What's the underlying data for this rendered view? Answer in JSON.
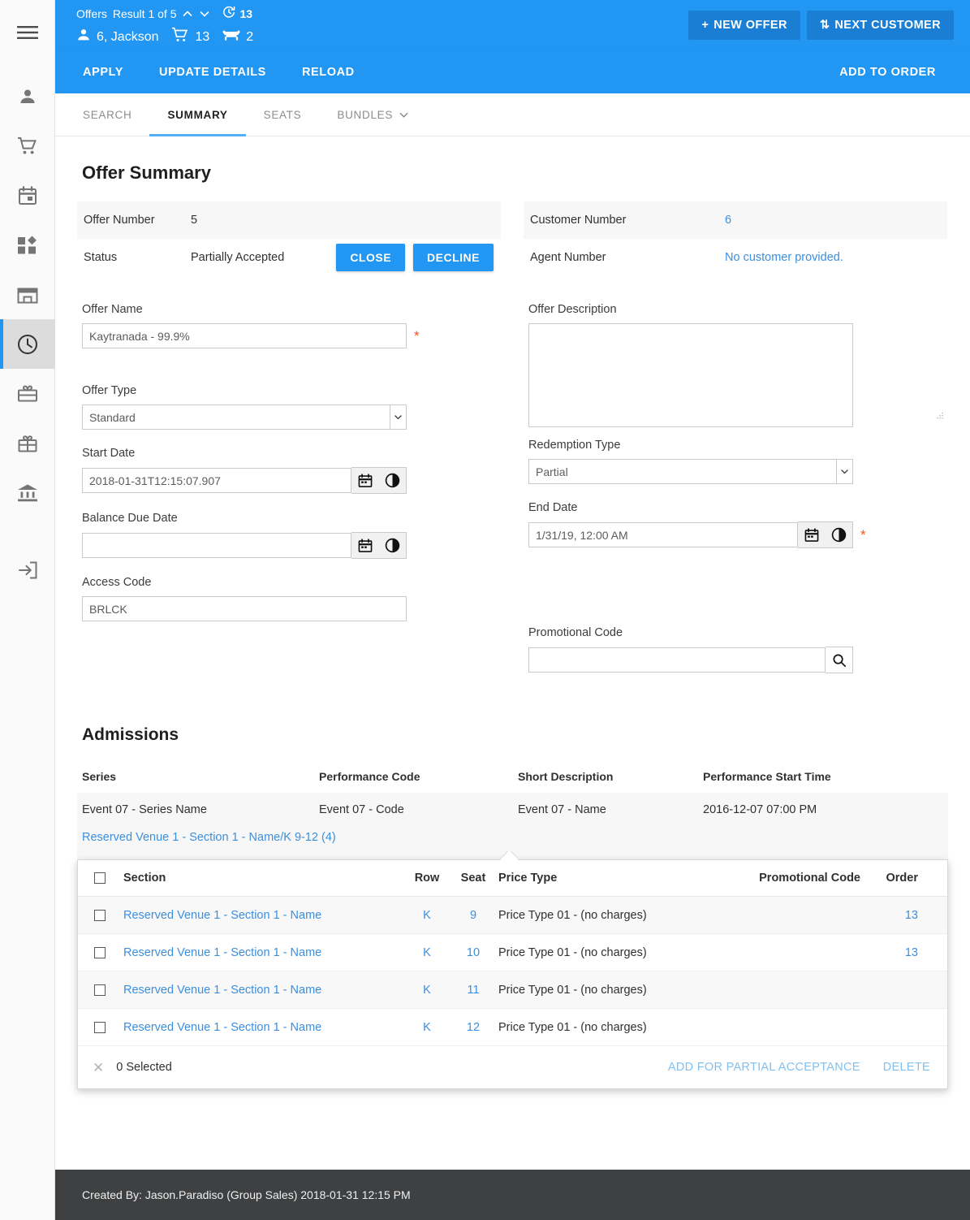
{
  "sidebar": {
    "items": [
      {
        "icon": "hamburger-menu-icon",
        "name": "menu"
      },
      {
        "icon": "person-icon",
        "name": "customers"
      },
      {
        "icon": "shopping-cart-icon",
        "name": "cart"
      },
      {
        "icon": "calendar-icon",
        "name": "calendar"
      },
      {
        "icon": "dashboard-blocks-icon",
        "name": "dashboard"
      },
      {
        "icon": "storefront-icon",
        "name": "venues"
      },
      {
        "icon": "clock-history-icon",
        "name": "offers",
        "active": true
      },
      {
        "icon": "voucher-icon",
        "name": "vouchers"
      },
      {
        "icon": "gift-icon",
        "name": "gifts"
      },
      {
        "icon": "bank-icon",
        "name": "finance"
      },
      {
        "icon": "logout-icon",
        "name": "logout"
      }
    ]
  },
  "header": {
    "module_label": "Offers",
    "result_text": "Result 1 of 5",
    "timer_count": "13",
    "customer": "6, Jackson",
    "cart_count": "13",
    "seat_count": "2",
    "new_offer_label": "NEW OFFER",
    "new_offer_prefix": "+",
    "next_customer_label": "NEXT CUSTOMER",
    "next_customer_prefix": "⇅"
  },
  "actionbar": {
    "items": [
      "APPLY",
      "UPDATE DETAILS",
      "RELOAD"
    ],
    "right_action": "ADD TO ORDER"
  },
  "tabs": [
    {
      "label": "SEARCH",
      "active": false,
      "caret": false
    },
    {
      "label": "SUMMARY",
      "active": true,
      "caret": false
    },
    {
      "label": "SEATS",
      "active": false,
      "caret": false
    },
    {
      "label": "BUNDLES",
      "active": false,
      "caret": true
    }
  ],
  "main": {
    "page_title": "Offer Summary",
    "left_summary": [
      {
        "key": "Offer Number",
        "value": "5",
        "shaded": true
      },
      {
        "key": "Status",
        "value": "Partially Accepted",
        "shaded": false
      }
    ],
    "status_buttons": [
      "CLOSE",
      "DECLINE"
    ],
    "right_summary": [
      {
        "key": "Customer Number",
        "value": "6",
        "link": true,
        "shaded": true
      },
      {
        "key": "Agent Number",
        "value": "No customer provided.",
        "link": true,
        "shaded": false
      }
    ],
    "fields": {
      "offer_name_label": "Offer Name",
      "offer_name_value": "Kaytranada - 99.9%",
      "offer_description_label": "Offer Description",
      "offer_description_value": "",
      "offer_type_label": "Offer Type",
      "offer_type_value": "Standard",
      "redemption_type_label": "Redemption Type",
      "redemption_type_value": "Partial",
      "start_date_label": "Start Date",
      "start_date_value": "2018-01-31T12:15:07.907",
      "end_date_label": "End Date",
      "end_date_value": "1/31/19, 12:00 AM",
      "balance_due_date_label": "Balance Due Date",
      "balance_due_date_value": "",
      "access_code_label": "Access Code",
      "access_code_value": "BRLCK",
      "promotional_code_label": "Promotional Code",
      "promotional_code_value": ""
    }
  },
  "admissions": {
    "title": "Admissions",
    "columns": [
      "Series",
      "Performance Code",
      "Short Description",
      "Performance Start Time"
    ],
    "rows": [
      {
        "series": "Event 07 - Series Name",
        "performance_code": "Event 07 - Code",
        "short_description": "Event 07 - Name",
        "start_time": "2016-12-07 07:00 PM",
        "seat_link": "Reserved Venue 1 - Section 1 - Name/K 9-12 (4)"
      }
    ]
  },
  "seats_panel": {
    "columns": [
      "Section",
      "Row",
      "Seat",
      "Price Type",
      "Promotional Code",
      "Order"
    ],
    "rows": [
      {
        "section": "Reserved Venue 1 - Section 1 - Name",
        "row": "K",
        "seat": "9",
        "price_type": "Price Type 01 - (no charges)",
        "promo": "",
        "order": "13"
      },
      {
        "section": "Reserved Venue 1 - Section 1 - Name",
        "row": "K",
        "seat": "10",
        "price_type": "Price Type 01 - (no charges)",
        "promo": "",
        "order": "13"
      },
      {
        "section": "Reserved Venue 1 - Section 1 - Name",
        "row": "K",
        "seat": "11",
        "price_type": "Price Type 01 - (no charges)",
        "promo": "",
        "order": ""
      },
      {
        "section": "Reserved Venue 1 - Section 1 - Name",
        "row": "K",
        "seat": "12",
        "price_type": "Price Type 01 - (no charges)",
        "promo": "",
        "order": ""
      }
    ],
    "selected_text": "0 Selected",
    "add_partial_label": "ADD FOR PARTIAL ACCEPTANCE",
    "delete_label": "DELETE"
  },
  "footer": {
    "text": "Created By: Jason.Paradiso (Group Sales) 2018-01-31 12:15 PM"
  },
  "colors": {
    "brand_blue": "#2196f3",
    "brand_blue_dark": "#1a7fd4",
    "link_blue": "#3b8fdd",
    "required_red": "#f4511e",
    "footer_bg": "#3f4042"
  }
}
